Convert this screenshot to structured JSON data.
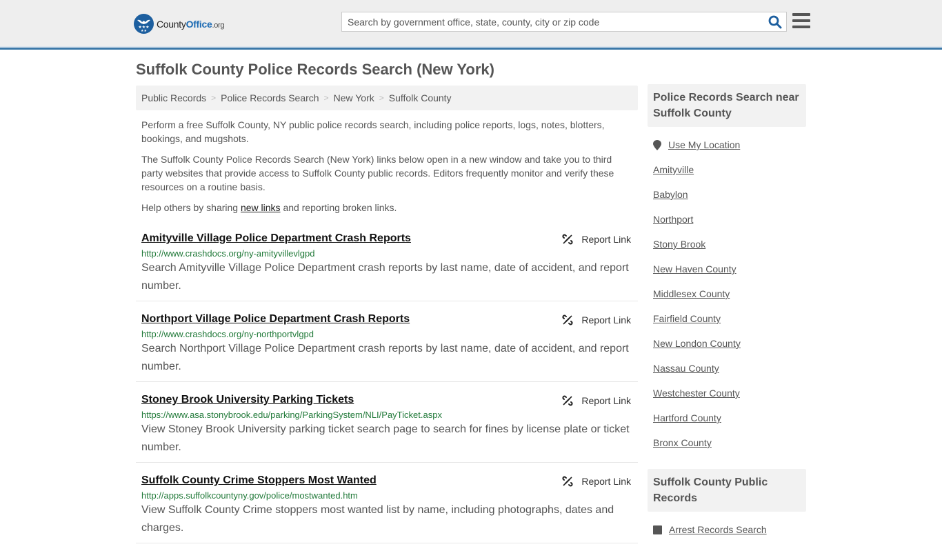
{
  "header": {
    "logo_text_a": "County",
    "logo_text_b": "Office",
    "logo_text_c": ".org",
    "search_placeholder": "Search by government office, state, county, city or zip code",
    "search_icon": "search-icon",
    "menu_icon": "hamburger-menu-icon"
  },
  "page": {
    "title": "Suffolk County Police Records Search (New York)"
  },
  "breadcrumb": [
    "Public Records",
    "Police Records Search",
    "New York",
    "Suffolk County"
  ],
  "intro": {
    "p1": "Perform a free Suffolk County, NY public police records search, including police reports, logs, notes, blotters, bookings, and mugshots.",
    "p2": "The Suffolk County Police Records Search (New York) links below open in a new window and take you to third party websites that provide access to Suffolk County public records. Editors frequently monitor and verify these resources on a routine basis.",
    "p3_before": "Help others by sharing ",
    "p3_link": "new links",
    "p3_after": " and reporting broken links."
  },
  "results": [
    {
      "title": "Amityville Village Police Department Crash Reports",
      "url": "http://www.crashdocs.org/ny-amityvillevlgpd",
      "description": "Search Amityville Village Police Department crash reports by last name, date of accident, and report number.",
      "report_label": "Report Link"
    },
    {
      "title": "Northport Village Police Department Crash Reports",
      "url": "http://www.crashdocs.org/ny-northportvlgpd",
      "description": "Search Northport Village Police Department crash reports by last name, date of accident, and report number.",
      "report_label": "Report Link"
    },
    {
      "title": "Stoney Brook University Parking Tickets",
      "url": "https://www.asa.stonybrook.edu/parking/ParkingSystem/NLI/PayTicket.aspx",
      "description": "View Stoney Brook University parking ticket search page to search for fines by license plate or ticket number.",
      "report_label": "Report Link"
    },
    {
      "title": "Suffolk County Crime Stoppers Most Wanted",
      "url": "http://apps.suffolkcountyny.gov/police/mostwanted.htm",
      "description": "View Suffolk County Crime stoppers most wanted list by name, including photographs, dates and charges.",
      "report_label": "Report Link"
    }
  ],
  "sidebar": {
    "nearby_heading": "Police Records Search near Suffolk County",
    "use_location": "Use My Location",
    "nearby": [
      "Amityville",
      "Babylon",
      "Northport",
      "Stony Brook",
      "New Haven County",
      "Middlesex County",
      "Fairfield County",
      "New London County",
      "Nassau County",
      "Westchester County",
      "Hartford County",
      "Bronx County"
    ],
    "public_records_heading": "Suffolk County Public Records",
    "public_records": [
      "Arrest Records Search"
    ]
  }
}
